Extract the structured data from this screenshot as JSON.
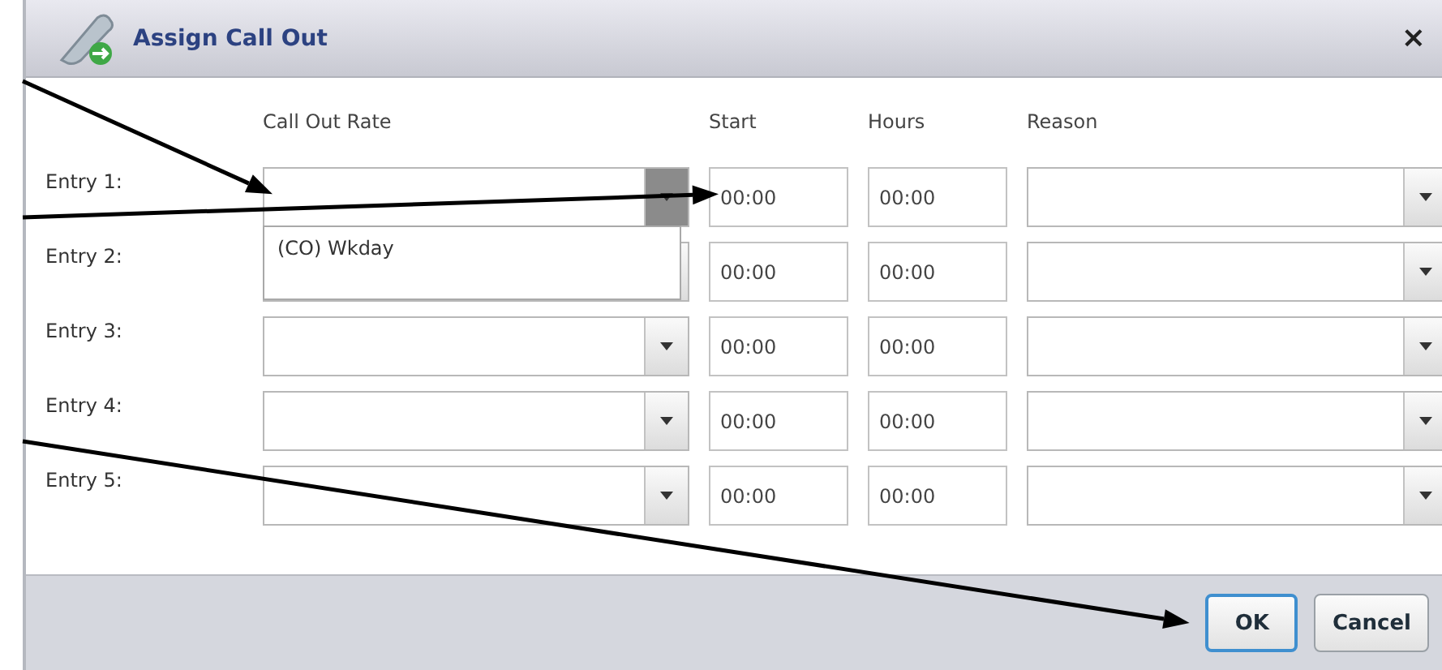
{
  "window": {
    "title": "Assign Call Out",
    "close": "×"
  },
  "columns": [
    "Call Out Rate",
    "Start",
    "Hours",
    "Reason"
  ],
  "entries": [
    {
      "label": "Entry 1:",
      "rate_open": true,
      "start": "00:00",
      "hours": "00:00",
      "rate_arrow": true,
      "start_arrow": true
    },
    {
      "label": "Entry 2:",
      "rate_open": false,
      "start": "00:00",
      "hours": "00:00"
    },
    {
      "label": "Entry 3:",
      "rate_open": false,
      "start": "00:00",
      "hours": "00:00"
    },
    {
      "label": "Entry 4:",
      "rate_open": false,
      "start": "00:00",
      "hours": "00:00"
    },
    {
      "label": "Entry 5:",
      "rate_open": false,
      "start": "00:00",
      "hours": "00:00"
    }
  ],
  "rate_options": [
    "(CO) Wkday"
  ],
  "buttons": [
    {
      "label": "OK",
      "focused": true,
      "arrow": true
    },
    {
      "label": "Cancel",
      "focused": false
    }
  ]
}
